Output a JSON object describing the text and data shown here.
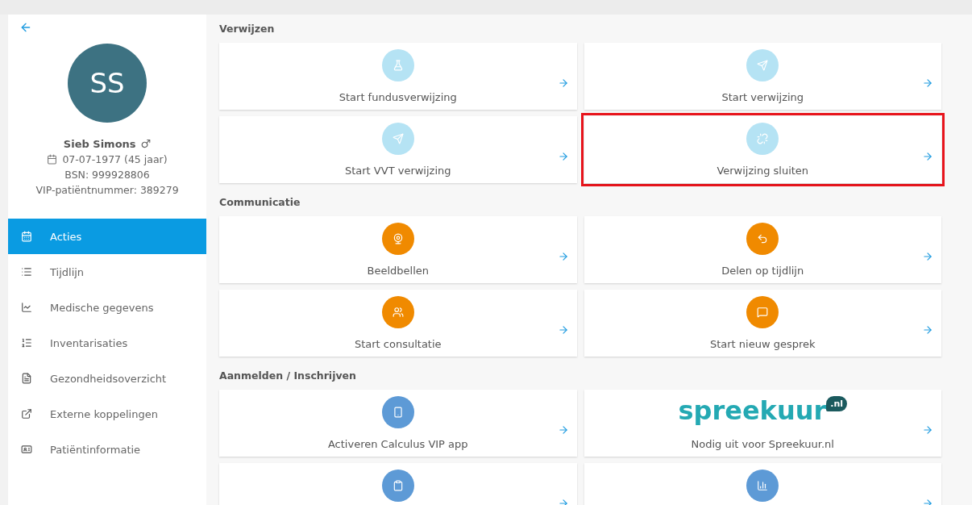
{
  "patient": {
    "initials": "SS",
    "name": "Sieb Simons",
    "gender_symbol": "♂",
    "birth": "07-07-1977  (45 jaar)",
    "bsn": "BSN: 999928806",
    "vip": "VIP-patiëntnummer: 389279"
  },
  "nav": [
    {
      "label": "Acties",
      "selected": true
    },
    {
      "label": "Tijdlijn",
      "selected": false
    },
    {
      "label": "Medische gegevens",
      "selected": false
    },
    {
      "label": "Inventarisaties",
      "selected": false
    },
    {
      "label": "Gezondheidsoverzicht",
      "selected": false
    },
    {
      "label": "Externe koppelingen",
      "selected": false
    },
    {
      "label": "Patiëntinformatie",
      "selected": false
    }
  ],
  "sections": [
    {
      "title": "Verwijzen",
      "cards": [
        {
          "kind": "icon",
          "color": "#b5e3f4",
          "label": "Start fundusverwijzing",
          "highlighted": false
        },
        {
          "kind": "icon",
          "color": "#b5e3f4",
          "label": "Start verwijzing",
          "highlighted": false
        },
        {
          "kind": "icon",
          "color": "#b5e3f4",
          "label": "Start VVT verwijzing",
          "highlighted": false
        },
        {
          "kind": "icon",
          "color": "#b5e3f4",
          "label": "Verwijzing sluiten",
          "highlighted": true
        }
      ]
    },
    {
      "title": "Communicatie",
      "cards": [
        {
          "kind": "icon",
          "color": "#f08a00",
          "label": "Beeldbellen",
          "highlighted": false
        },
        {
          "kind": "icon",
          "color": "#f08a00",
          "label": "Delen op tijdlijn",
          "highlighted": false
        },
        {
          "kind": "icon",
          "color": "#f08a00",
          "label": "Start consultatie",
          "highlighted": false
        },
        {
          "kind": "icon",
          "color": "#f08a00",
          "label": "Start nieuw gesprek",
          "highlighted": false
        }
      ]
    },
    {
      "title": "Aanmelden / Inschrijven",
      "cards": [
        {
          "kind": "icon",
          "color": "#5d9ad6",
          "label": "Activeren Calculus VIP app",
          "highlighted": false
        },
        {
          "kind": "logo",
          "logo_text": "spreekuur",
          "logo_badge": ".nl",
          "label": "Nodig uit voor Spreekuur.nl",
          "highlighted": false
        },
        {
          "kind": "icon",
          "color": "#5d9ad6",
          "highlighted": false
        },
        {
          "kind": "icon",
          "color": "#5d9ad6",
          "highlighted": false
        }
      ]
    }
  ]
}
